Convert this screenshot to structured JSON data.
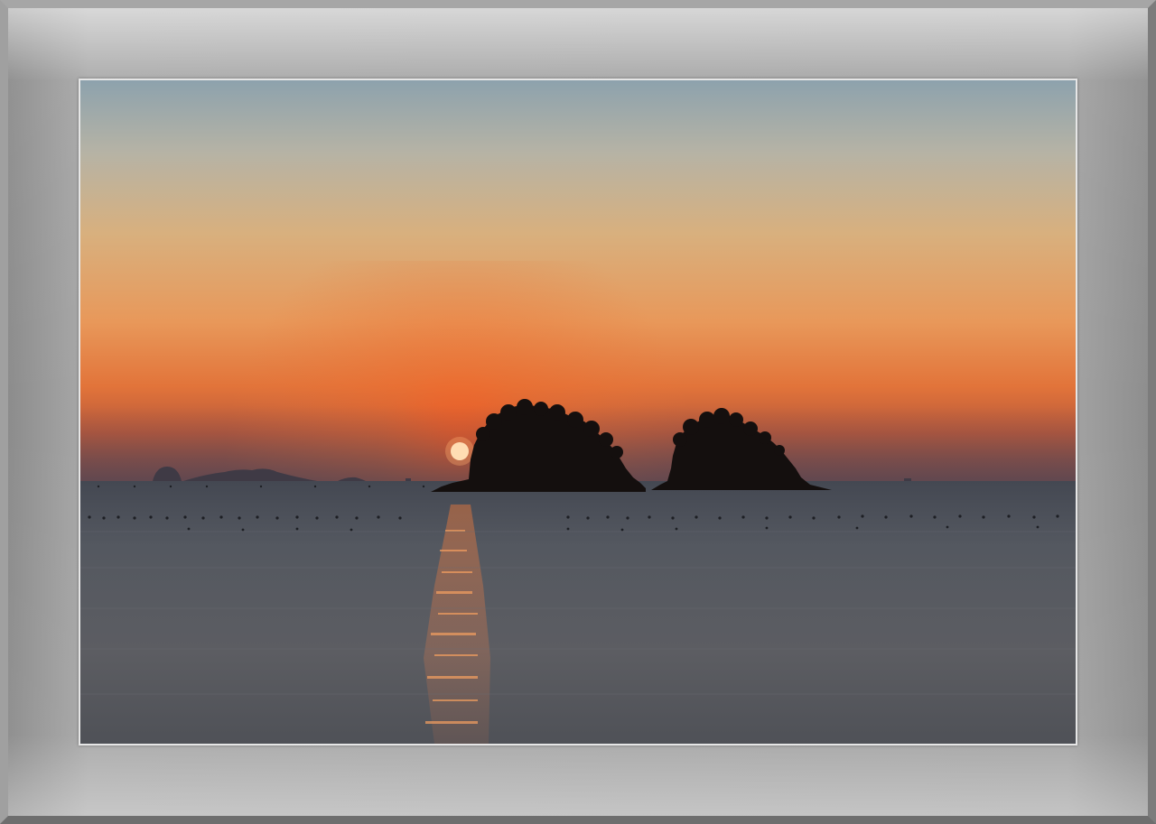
{
  "photo": {
    "subject": "sunset-over-sea-with-two-islands",
    "colors": {
      "sky_top": "#8fa3ad",
      "sky_mid": "#d9b07c",
      "sky_glow": "#e9833f",
      "horizon_haze": "#6b4a4c",
      "sun": "#fff6d8",
      "sea": "#4d5158",
      "island_silhouette": "#140f0e",
      "frame": "#a0a0a0",
      "mat_border": "#e6e6e6"
    },
    "icons": [
      "sun-icon",
      "island-icon"
    ]
  }
}
